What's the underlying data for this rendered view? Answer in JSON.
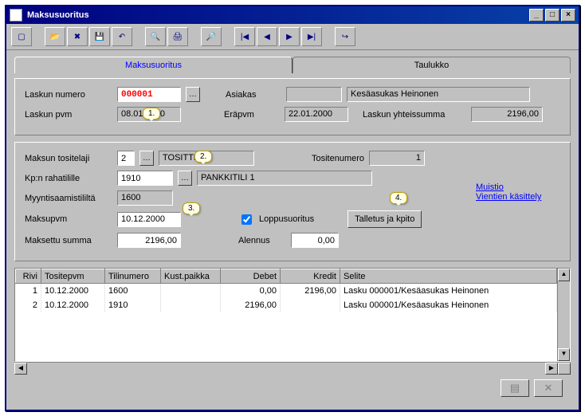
{
  "window": {
    "title": "Maksusuoritus"
  },
  "tabs": {
    "active": "Maksusuoritus",
    "other": "Taulukko"
  },
  "labels": {
    "laskun_numero": "Laskun numero",
    "asiakas": "Asiakas",
    "laskun_pvm": "Laskun pvm",
    "erapvm": "Eräpvm",
    "laskun_yhteissumma": "Laskun yhteissumma",
    "maksun_tositelaji": "Maksun tositelaji",
    "tositenumero": "Tositenumero",
    "kpn_rahatilille": "Kp:n rahatilille",
    "myyntisaamistililta": "Myyntisaamistililtä",
    "maksupvm": "Maksupvm",
    "loppusuoritus": "Loppusuoritus",
    "maksettu_summa": "Maksettu summa",
    "alennus": "Alennus",
    "talletus": "Talletus ja kpito"
  },
  "values": {
    "laskun_numero": "000001",
    "asiakas_ro": "",
    "asiakas": "Kesäasukas Heinonen",
    "laskun_pvm": "08.01.2000",
    "erapvm": "22.01.2000",
    "yhteissumma": "2196,00",
    "tositelaji": "2",
    "tositelaji_nimi": "TOSITTEET",
    "tositenumero": "1",
    "rahatilille": "1910",
    "rahatilille_nimi": "PANKKITILI 1",
    "myyntisaamistililta": "1600",
    "maksupvm": "10.12.2000",
    "maksettu_summa": "2196,00",
    "alennus": "0,00",
    "loppusuoritus_checked": true
  },
  "callouts": {
    "c1": "1.",
    "c2": "2.",
    "c3": "3.",
    "c4": "4."
  },
  "links": {
    "muistio": "Muistio",
    "vientien": "Vientien käsittely"
  },
  "grid": {
    "headers": [
      "Rivi",
      "Tositepvm",
      "Tilinumero",
      "Kust.paikka",
      "Debet",
      "Kredit",
      "Selite"
    ],
    "rows": [
      {
        "rivi": "1",
        "tositepvm": "10.12.2000",
        "tili": "1600",
        "kust": "",
        "debet": "0,00",
        "kredit": "2196,00",
        "selite": "Lasku 000001/Kesäasukas Heinonen"
      },
      {
        "rivi": "2",
        "tositepvm": "10.12.2000",
        "tili": "1910",
        "kust": "",
        "debet": "2196,00",
        "kredit": "",
        "selite": "Lasku 000001/Kesäasukas Heinonen"
      }
    ]
  }
}
